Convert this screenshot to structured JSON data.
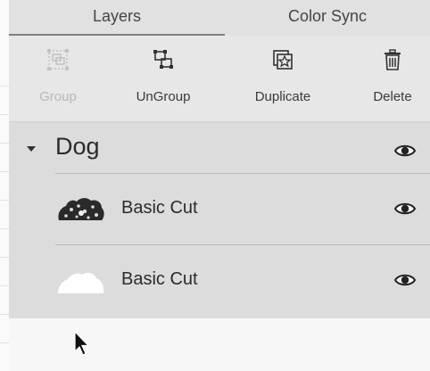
{
  "tabs": {
    "layers": "Layers",
    "color_sync": "Color Sync"
  },
  "toolbar": {
    "group": {
      "label": "Group",
      "icon": "group-icon",
      "enabled": false
    },
    "ungroup": {
      "label": "UnGroup",
      "icon": "ungroup-icon",
      "enabled": true
    },
    "duplicate": {
      "label": "Duplicate",
      "icon": "duplicate-icon",
      "enabled": true
    },
    "delete": {
      "label": "Delete",
      "icon": "trash-icon",
      "enabled": true
    }
  },
  "layers": {
    "group": {
      "name": "Dog",
      "expanded": true,
      "visibility_icon": "eye-icon"
    },
    "items": [
      {
        "name": "Basic Cut",
        "thumbnail": "dog-cut-thumbnail",
        "visibility_icon": "eye-icon"
      },
      {
        "name": "Basic Cut",
        "thumbnail": "white-shape-thumbnail",
        "visibility_icon": "eye-icon"
      }
    ]
  },
  "colors": {
    "tab_bar": "#e1e1e1",
    "toolbar": "#e7e7e7",
    "layer_tree": "#dcdcdc",
    "disabled_text": "#b8b8b8"
  }
}
